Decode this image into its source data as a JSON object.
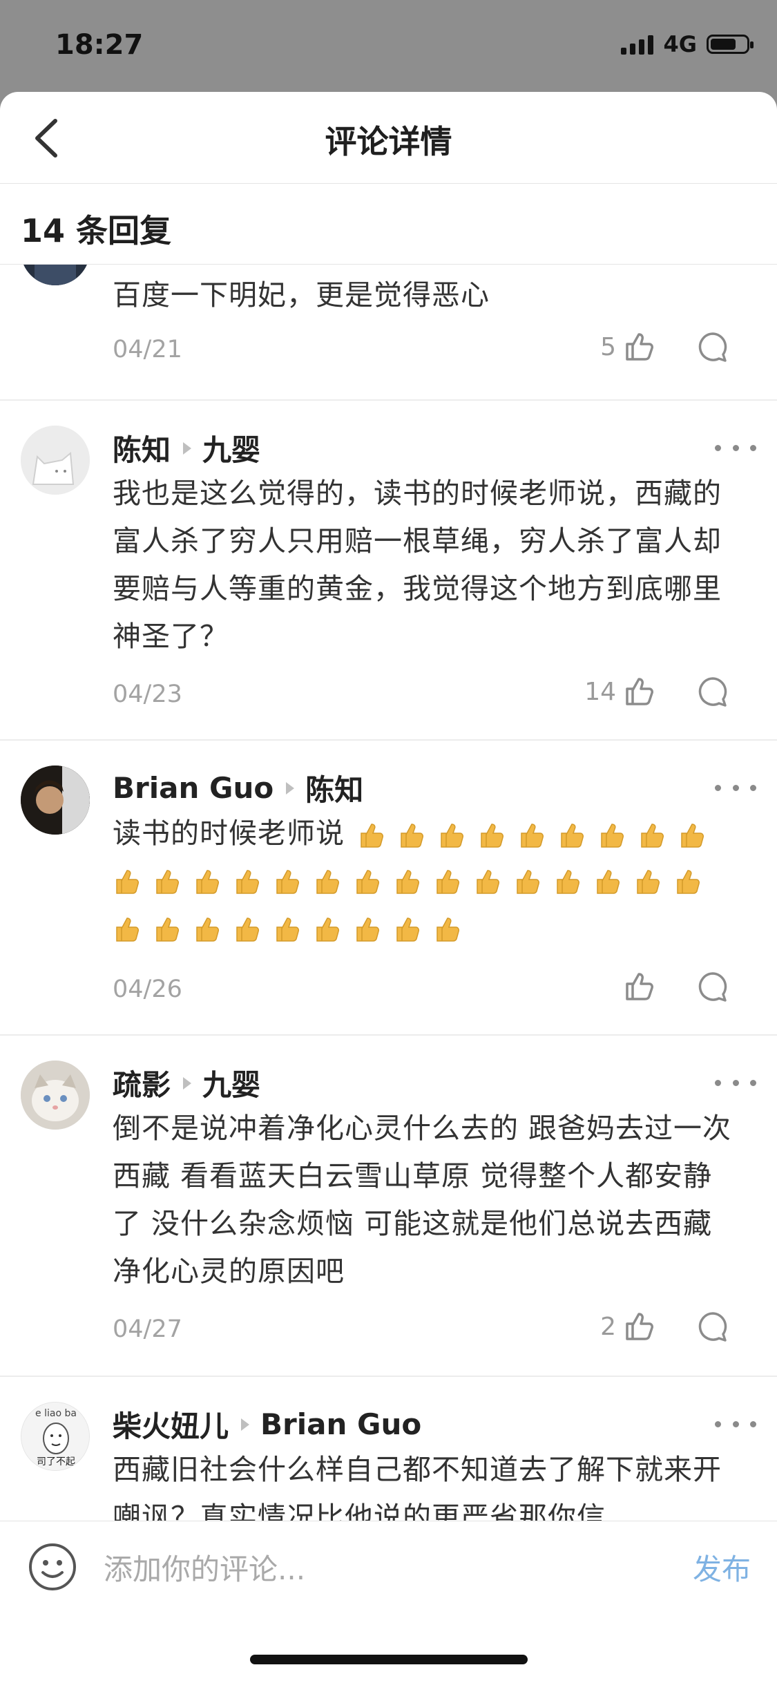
{
  "status": {
    "time": "18:27",
    "network": "4G"
  },
  "nav": {
    "title": "评论详情"
  },
  "reply_header": {
    "count_text": "14 条回复"
  },
  "comments": [
    {
      "user": "",
      "reply_to": "",
      "text": "百度一下明妃，更是觉得恶心",
      "date": "04/21",
      "likes": "5"
    },
    {
      "user": "陈知",
      "reply_to": "九婴",
      "text": "我也是这么觉得的，读书的时候老师说，西藏的富人杀了穷人只用赔一根草绳，穷人杀了富人却要赔与人等重的黄金，我觉得这个地方到底哪里神圣了？",
      "date": "04/23",
      "likes": "14"
    },
    {
      "user": "Brian Guo",
      "reply_to": "陈知",
      "text": "读书的时候老师说",
      "thumbs_count": 33,
      "date": "04/26",
      "likes": ""
    },
    {
      "user": "疏影",
      "reply_to": "九婴",
      "text": "倒不是说冲着净化心灵什么去的 跟爸妈去过一次西藏 看看蓝天白云雪山草原 觉得整个人都安静了 没什么杂念烦恼 可能这就是他们总说去西藏净化心灵的原因吧",
      "date": "04/27",
      "likes": "2"
    },
    {
      "user": "柴火妞儿",
      "reply_to": "Brian Guo",
      "text": "西藏旧社会什么样自己都不知道去了解下就来开嘲讽？真实情况比他说的更严省那你信",
      "date": "",
      "likes": ""
    }
  ],
  "avatar5_text": {
    "top": "e liao ba",
    "bottom": "司了不起"
  },
  "input": {
    "placeholder": "添加你的评论...",
    "publish": "发布"
  },
  "colors": {
    "accent": "#7fb2e3",
    "thumb": "#f2b845"
  }
}
